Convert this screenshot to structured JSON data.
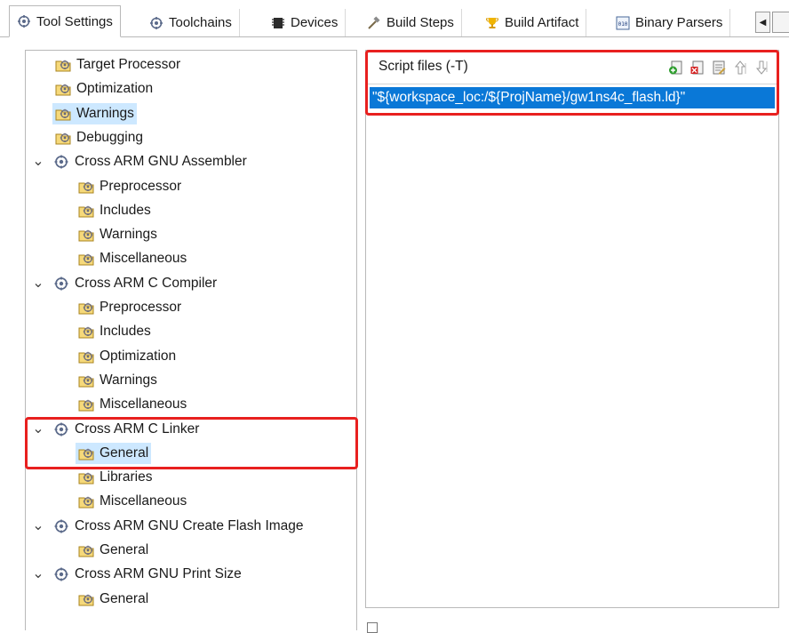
{
  "tabs": [
    {
      "label": "Tool Settings",
      "icon": "gear-icon",
      "active": true
    },
    {
      "label": "Toolchains",
      "icon": "gear-icon",
      "active": false
    },
    {
      "label": "Devices",
      "icon": "chip-icon",
      "active": false
    },
    {
      "label": "Build Steps",
      "icon": "hammer-icon",
      "active": false
    },
    {
      "label": "Build Artifact",
      "icon": "trophy-icon",
      "active": false
    },
    {
      "label": "Binary Parsers",
      "icon": "binary-icon",
      "active": false
    }
  ],
  "tab_scroll_left": "◀",
  "tree": {
    "items": [
      {
        "label": "Target Processor",
        "type": "leaf"
      },
      {
        "label": "Optimization",
        "type": "leaf"
      },
      {
        "label": "Warnings",
        "type": "leaf",
        "selected": true
      },
      {
        "label": "Debugging",
        "type": "leaf"
      },
      {
        "label": "Cross ARM GNU Assembler",
        "type": "tool",
        "expanded": true
      },
      {
        "label": "Preprocessor",
        "type": "leaf"
      },
      {
        "label": "Includes",
        "type": "leaf"
      },
      {
        "label": "Warnings",
        "type": "leaf"
      },
      {
        "label": "Miscellaneous",
        "type": "leaf"
      },
      {
        "label": "Cross ARM C Compiler",
        "type": "tool",
        "expanded": true
      },
      {
        "label": "Preprocessor",
        "type": "leaf"
      },
      {
        "label": "Includes",
        "type": "leaf"
      },
      {
        "label": "Optimization",
        "type": "leaf"
      },
      {
        "label": "Warnings",
        "type": "leaf"
      },
      {
        "label": "Miscellaneous",
        "type": "leaf"
      },
      {
        "label": "Cross ARM C Linker",
        "type": "tool",
        "expanded": true
      },
      {
        "label": "General",
        "type": "leaf",
        "selected": true
      },
      {
        "label": "Libraries",
        "type": "leaf"
      },
      {
        "label": "Miscellaneous",
        "type": "leaf"
      },
      {
        "label": "Cross ARM GNU Create Flash Image",
        "type": "tool",
        "expanded": true
      },
      {
        "label": "General",
        "type": "leaf"
      },
      {
        "label": "Cross ARM GNU Print Size",
        "type": "tool",
        "expanded": true
      },
      {
        "label": "General",
        "type": "leaf"
      }
    ]
  },
  "script_files": {
    "title": "Script files (-T)",
    "tools": [
      "add-icon",
      "delete-icon",
      "edit-icon",
      "move-up-icon",
      "move-down-icon"
    ],
    "entries": [
      "\"${workspace_loc:/${ProjName}/gw1ns4c_flash.ld}\""
    ]
  },
  "colors": {
    "highlight_red": "#e8201f",
    "selection_blue": "#0a78d7",
    "tree_selection": "#cde8ff"
  }
}
